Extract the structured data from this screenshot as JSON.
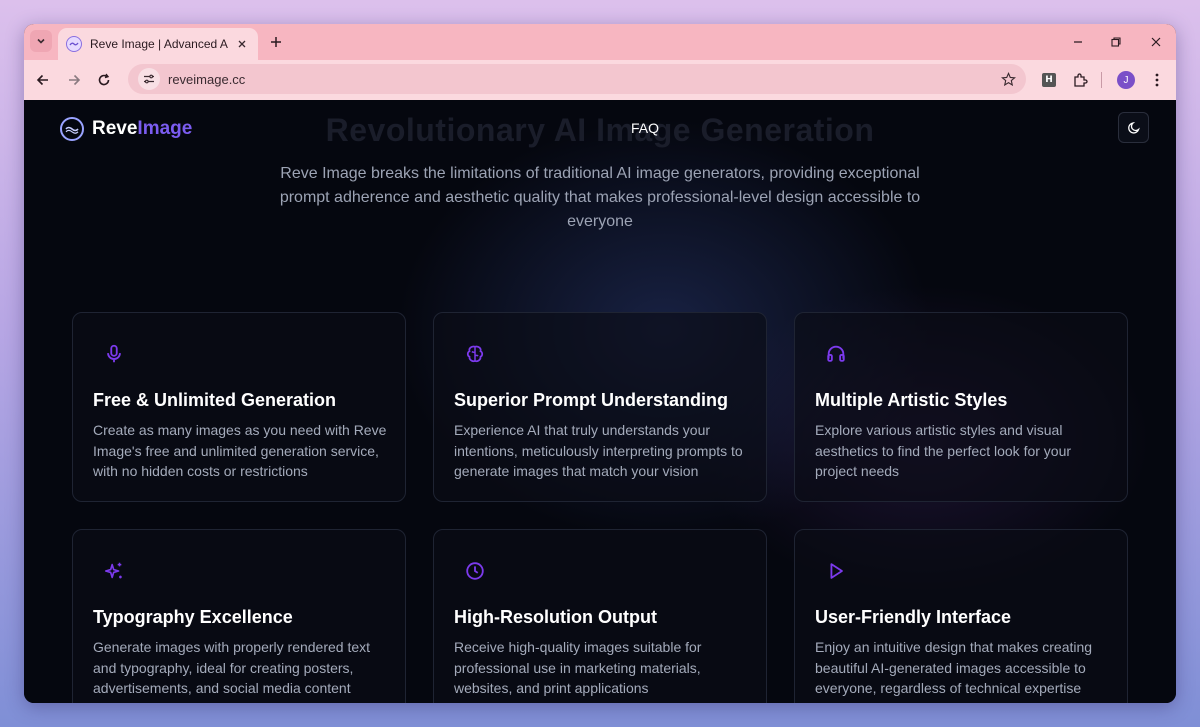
{
  "browser": {
    "tab_title": "Reve Image | Advanced AI Imag",
    "url": "reveimage.cc",
    "profile_initial": "J",
    "extension_label": "H"
  },
  "header": {
    "logo_primary": "Reve",
    "logo_accent": "Image",
    "nav_faq": "FAQ",
    "background_title": "Revolutionary AI Image Generation"
  },
  "hero": {
    "subtitle": "Reve Image breaks the limitations of traditional AI image generators, providing exceptional prompt adherence and aesthetic quality that makes professional-level design accessible to everyone"
  },
  "features": [
    {
      "icon": "microphone-icon",
      "title": "Free & Unlimited Generation",
      "description": "Create as many images as you need with Reve Image's free and unlimited generation service, with no hidden costs or restrictions"
    },
    {
      "icon": "brain-icon",
      "title": "Superior Prompt Understanding",
      "description": "Experience AI that truly understands your intentions, meticulously interpreting prompts to generate images that match your vision"
    },
    {
      "icon": "headphones-icon",
      "title": "Multiple Artistic Styles",
      "description": "Explore various artistic styles and visual aesthetics to find the perfect look for your project needs"
    },
    {
      "icon": "sparkles-icon",
      "title": "Typography Excellence",
      "description": "Generate images with properly rendered text and typography, ideal for creating posters, advertisements, and social media content"
    },
    {
      "icon": "clock-icon",
      "title": "High-Resolution Output",
      "description": "Receive high-quality images suitable for professional use in marketing materials, websites, and print applications"
    },
    {
      "icon": "play-icon",
      "title": "User-Friendly Interface",
      "description": "Enjoy an intuitive design that makes creating beautiful AI-generated images accessible to everyone, regardless of technical expertise"
    }
  ],
  "colors": {
    "accent": "#7b5cf0",
    "icon": "#7c3aed",
    "page_background": "#05070f",
    "tabbar": "#f7b6c1"
  }
}
